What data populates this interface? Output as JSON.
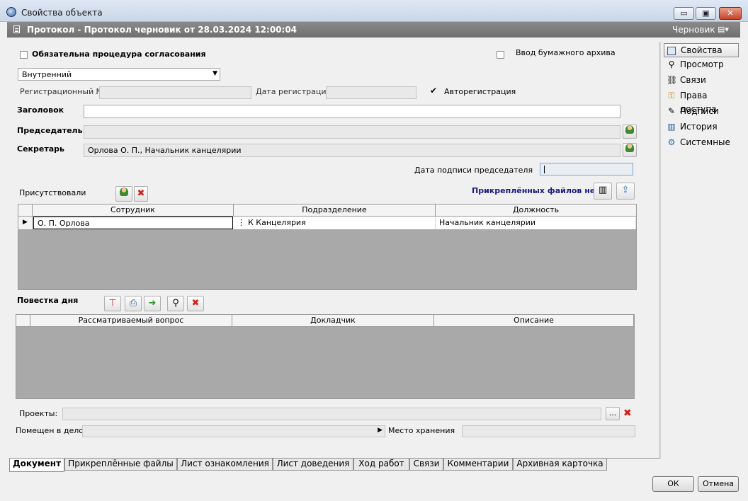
{
  "window": {
    "title": "Свойства объекта",
    "minimize": "▭",
    "maximize": "▣",
    "close": "✕"
  },
  "header": {
    "doc_title": "Протокол - Протокол  черновик  от 28.03.2024 12:00:04",
    "status": "Черновик"
  },
  "form": {
    "mandatory_approval_label": "Обязательна процедура согласования",
    "paper_archive_label": "Ввод бумажного архива",
    "type_value": "Внутренний",
    "reg_number_label": "Регистрационный №",
    "reg_number_value": "",
    "reg_date_label": "Дата регистрации",
    "reg_date_value": "",
    "auto_registration_label": "Авторегистрация",
    "auto_registration_checked": true,
    "heading_label": "Заголовок",
    "heading_value": "",
    "chairman_label": "Председатель",
    "chairman_value": "",
    "secretary_label": "Секретарь",
    "secretary_value": "Орлова О. П., Начальник канцелярии",
    "chairman_sign_date_label": "Дата подписи председателя",
    "present_label": "Присутствовали",
    "no_attachments": "Прикреплённых файлов нет"
  },
  "attendees_grid": {
    "headers": [
      "Сотрудник",
      "Подразделение",
      "Должность"
    ],
    "rows": [
      {
        "employee": "О. П. Орлова",
        "department": "К Канцелярия",
        "position": "Начальник канцелярии"
      }
    ]
  },
  "agenda": {
    "label": "Повестка дня",
    "headers": [
      "Рассматриваемый вопрос",
      "Докладчик",
      "Описание"
    ]
  },
  "projects": {
    "label": "Проекты:",
    "browse": "...",
    "value": ""
  },
  "case": {
    "placed_label": "Помещен в дело",
    "placed_value": "",
    "storage_label": "Место хранения",
    "storage_value": ""
  },
  "sidebar": {
    "items": [
      {
        "label": "Свойства",
        "icon": "properties-icon"
      },
      {
        "label": "Просмотр",
        "icon": "magnifier-icon"
      },
      {
        "label": "Связи",
        "icon": "link-icon"
      },
      {
        "label": "Права доступа",
        "icon": "key-icon"
      },
      {
        "label": "Подписи",
        "icon": "pen-icon"
      },
      {
        "label": "История",
        "icon": "book-icon"
      },
      {
        "label": "Системные",
        "icon": "system-icon"
      }
    ]
  },
  "tabs": [
    "Документ",
    "Прикреплённые файлы",
    "Лист ознакомления",
    "Лист доведения",
    "Ход работ",
    "Связи",
    "Комментарии",
    "Архивная карточка"
  ],
  "buttons": {
    "ok": "ОК",
    "cancel": "Отмена"
  }
}
